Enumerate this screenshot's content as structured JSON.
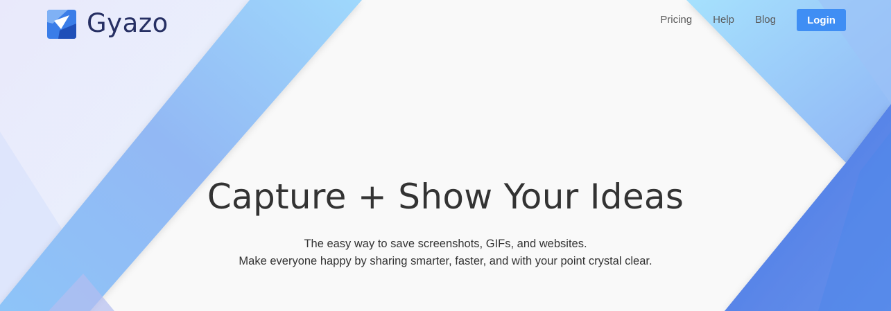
{
  "brand": {
    "name": "Gyazo",
    "logo_icon": "gyazo-g-logo-icon",
    "text_color": "#262f63",
    "icon_color": "#2a6fe8"
  },
  "nav": {
    "links": [
      {
        "label": "Pricing"
      },
      {
        "label": "Help"
      },
      {
        "label": "Blog"
      }
    ],
    "login_label": "Login",
    "login_color": "#3f8ef4"
  },
  "hero": {
    "title": "Capture + Show Your Ideas",
    "subtitle_line1": "The easy way to save screenshots, GIFs, and websites.",
    "subtitle_line2": "Make everyone happy by sharing smarter, faster, and with your point crystal clear."
  },
  "theme": {
    "background": "#f9f9f9",
    "accent_light": "#9fd6fb",
    "accent_dark": "#3f6ee3"
  }
}
